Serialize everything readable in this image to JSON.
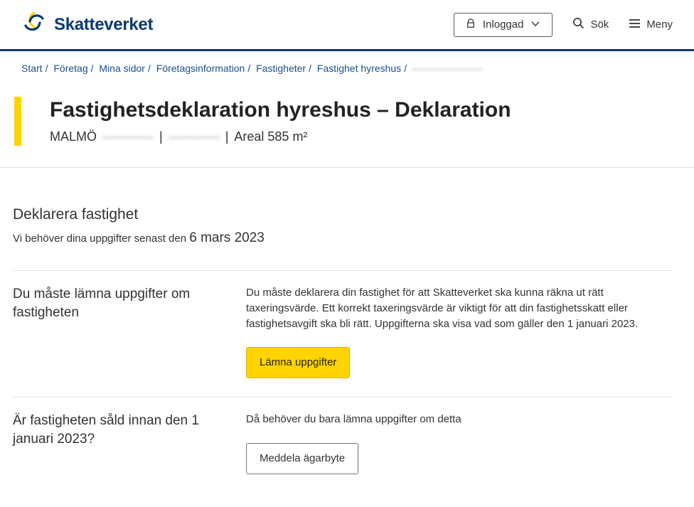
{
  "header": {
    "brand": "Skatteverket",
    "login_label": "Inloggad",
    "search_label": "Sök",
    "menu_label": "Meny"
  },
  "breadcrumbs": {
    "items": [
      "Start",
      "Företag",
      "Mina sidor",
      "Företagsinformation",
      "Fastigheter",
      "Fastighet hyreshus"
    ],
    "last_redacted": "———————"
  },
  "page": {
    "title": "Fastighetsdeklaration hyreshus – Deklaration",
    "city": "MALMÖ",
    "redacted1": "————",
    "redacted2": "————",
    "area": "Areal 585 m²"
  },
  "section": {
    "heading": "Deklarera fastighet",
    "deadline_prefix": "Vi behöver dina uppgifter senast den ",
    "deadline_date": "6 mars 2023"
  },
  "block1": {
    "heading": "Du måste lämna uppgifter om fastigheten",
    "body": "Du måste deklarera din fastighet för att Skatteverket ska kunna räkna ut rätt taxeringsvärde. Ett korrekt taxeringsvärde är viktigt för att din fastighetsskatt eller fastighetsavgift ska bli rätt. Uppgifterna ska visa vad som gäller den 1 januari 2023.",
    "button": "Lämna uppgifter"
  },
  "block2": {
    "heading": "Är fastigheten såld innan den 1 januari 2023?",
    "body": "Då behöver du bara lämna uppgifter om detta",
    "button": "Meddela ägarbyte"
  }
}
